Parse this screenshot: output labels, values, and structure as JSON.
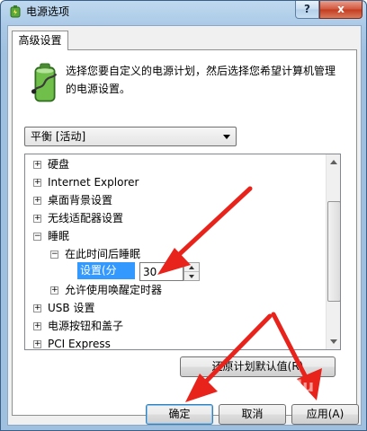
{
  "window": {
    "title": "电源选项",
    "help_label": "?",
    "close_label": "x"
  },
  "tab": {
    "label": "高级设置"
  },
  "description": "选择您要自定义的电源计划，然后选择您希望计算机管理的电源设置。",
  "plan_select": {
    "value": "平衡 [活动]"
  },
  "tree": {
    "items": [
      {
        "label": "硬盘",
        "expander": "+"
      },
      {
        "label": "Internet Explorer",
        "expander": "+"
      },
      {
        "label": "桌面背景设置",
        "expander": "+"
      },
      {
        "label": "无线适配器设置",
        "expander": "+"
      },
      {
        "label": "睡眠",
        "expander": "−"
      },
      {
        "label": "在此时间后睡眠",
        "expander": "−"
      },
      {
        "label": "允许使用唤醒定时器",
        "expander": "+"
      },
      {
        "label": "USB 设置",
        "expander": "+"
      },
      {
        "label": "电源按钮和盖子",
        "expander": "+"
      },
      {
        "label": "PCI Express",
        "expander": "+"
      }
    ],
    "setting_label": "设置(分钟):",
    "setting_value": "30"
  },
  "buttons": {
    "restore": "还原计划默认值(R)",
    "ok": "确定",
    "cancel": "取消",
    "apply": "应用(A)"
  },
  "watermark": "Bai du",
  "colors": {
    "annotation_arrows": "#e8231b",
    "selection": "#3399ff"
  }
}
